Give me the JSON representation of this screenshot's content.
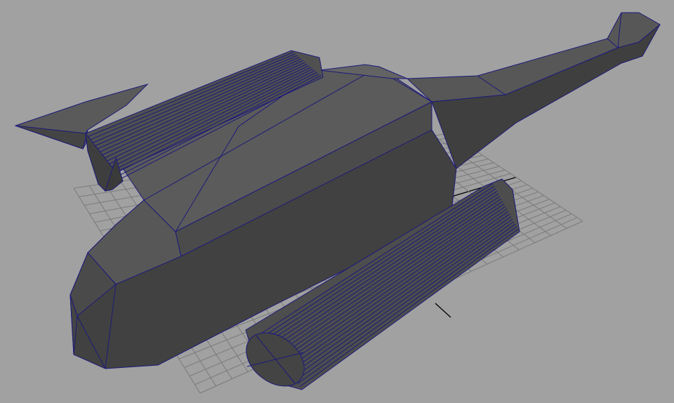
{
  "viewport": {
    "background_color": "#a1a1a1",
    "mesh_fill_color": "#4e4e4e",
    "mesh_dark_color": "#3c3c3c",
    "mesh_light_color": "#5d5d5d",
    "wireframe_color": "#1c1a7a",
    "grid_color": "#7a7a7a",
    "grid_axis_color": "#000000"
  },
  "objects": [
    {
      "name": "ship-hull",
      "type": "polygon-mesh"
    },
    {
      "name": "left-engine-nacelle",
      "type": "cylinder"
    },
    {
      "name": "detached-cylinder",
      "type": "cylinder"
    },
    {
      "name": "ground-grid",
      "type": "grid"
    }
  ]
}
